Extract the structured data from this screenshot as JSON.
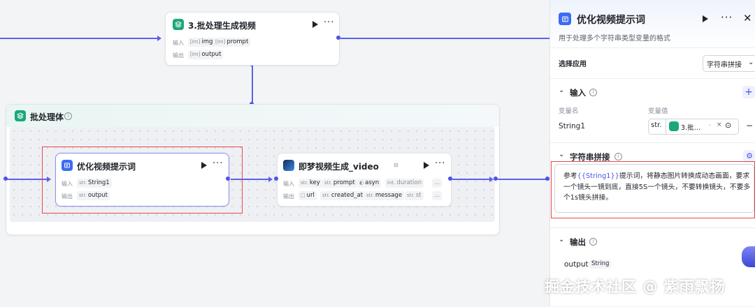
{
  "nodes": {
    "batch_generate": {
      "title": "3.批处理生成视频",
      "input_label": "输入",
      "output_label": "输出",
      "inputs": [
        {
          "type": "[Im]",
          "name": "img"
        },
        {
          "type": "[Im]",
          "name": "prompt"
        }
      ],
      "outputs": [
        {
          "type": "[Im]",
          "name": "output"
        }
      ]
    },
    "batch_body": {
      "title": "批处理体"
    },
    "optimize_prompt": {
      "title": "优化视频提示词",
      "input_label": "输入",
      "output_label": "输出",
      "inputs": [
        {
          "type": "str.",
          "name": "String1"
        }
      ],
      "outputs": [
        {
          "type": "str.",
          "name": "output"
        }
      ]
    },
    "jimeng_video": {
      "title": "即梦视频生成_video",
      "input_label": "输入",
      "output_label": "输出",
      "inputs": [
        {
          "type": "str.",
          "name": "key"
        },
        {
          "type": "str.",
          "name": "prompt"
        },
        {
          "type": "toggle",
          "name": "asyn"
        },
        {
          "type": "int.",
          "name": "duration"
        },
        {
          "type": "",
          "name": "..."
        }
      ],
      "outputs": [
        {
          "type": "□",
          "name": "url"
        },
        {
          "type": "str.",
          "name": "created_at"
        },
        {
          "type": "str.",
          "name": "message"
        },
        {
          "type": "str.",
          "name": "st"
        },
        {
          "type": "",
          "name": "..."
        }
      ]
    }
  },
  "panel": {
    "title": "优化视频提示词",
    "description": "用于处理多个字符串类型变量的格式",
    "select_app_label": "选择应用",
    "select_app_value": "字符串拼接",
    "input_section": "输入",
    "var_name_header": "变量名",
    "var_value_header": "变量值",
    "var_name": "String1",
    "var_type": "str.",
    "var_ref": "3.批…",
    "var_ref_suffix": "·",
    "concat_section": "字符串拼接",
    "template_prefix": "参考",
    "template_var": "{{String1}}",
    "template_rest": "提示词，将静态图片转换成动态画面，要求一个镜头一镜到底，直接5S一个镜头，不要转换镜头，不要多个1s镜头拼接。",
    "output_section": "输出",
    "output_name": "output",
    "output_type": "String"
  },
  "watermark": "掘金技术社区 @ 紫雨飘扬",
  "colors": {
    "accent": "#4d53e8",
    "highlight": "#e8484c",
    "teal": "#1aa77a"
  }
}
